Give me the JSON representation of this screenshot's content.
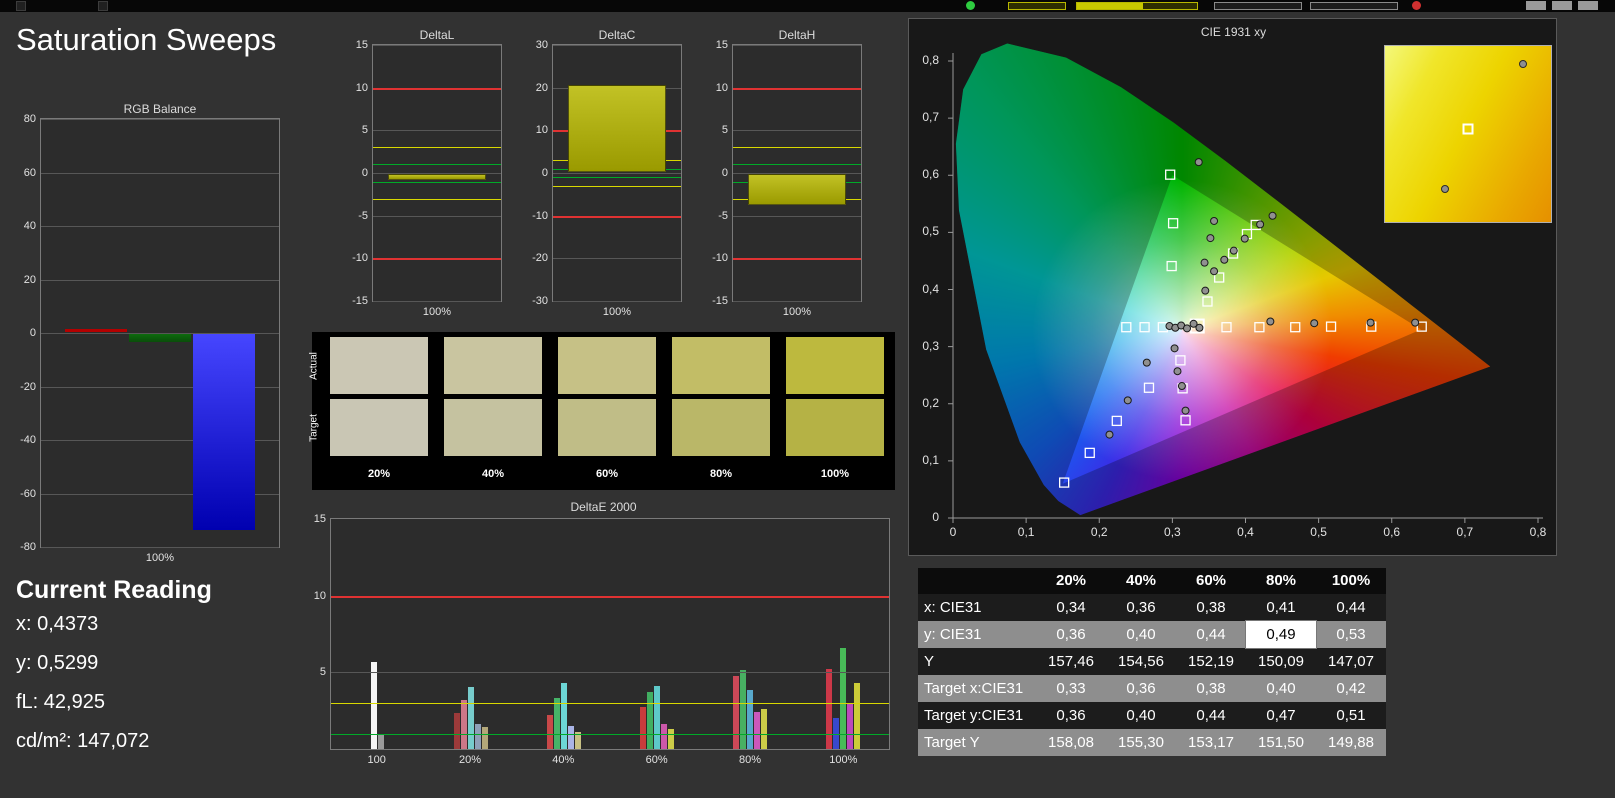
{
  "page": {
    "title": "Saturation Sweeps"
  },
  "colors": {
    "tolerance_red": "#e03232",
    "tolerance_yellow": "#d8d800",
    "tolerance_green": "#00aa28"
  },
  "top_bar": {
    "icons": [
      {
        "name": "status-dot",
        "color": "#2ecc40"
      },
      {
        "name": "record-dot",
        "color": "#d03030"
      }
    ]
  },
  "rgb_balance": {
    "title": "RGB Balance",
    "y_ticks": [
      "80",
      "60",
      "40",
      "20",
      "0",
      "-20",
      "-40",
      "-60",
      "-80"
    ],
    "ylim": [
      -80,
      80
    ],
    "x_label": "100%",
    "bars": [
      {
        "name": "red",
        "value": 1,
        "color": "#b40000",
        "color2": "#b40000"
      },
      {
        "name": "green",
        "value": -3,
        "color": "#0e6b0e",
        "color2": "#0a4d0a"
      },
      {
        "name": "blue",
        "value": -73,
        "color": "#4646ff",
        "color2": "#0000b0"
      }
    ]
  },
  "current_reading": {
    "title": "Current Reading",
    "lines": [
      "x: 0,4373",
      "y: 0,5299",
      "fL: 42,925",
      "cd/m²: 147,072"
    ]
  },
  "delta_charts": [
    {
      "title": "DeltaL",
      "ylim": 15,
      "y_ticks": [
        "15",
        "10",
        "5",
        "0",
        "-5",
        "-10",
        "-15"
      ],
      "x_label": "100%",
      "bar_value": -0.7
    },
    {
      "title": "DeltaC",
      "ylim": 30,
      "y_ticks": [
        "30",
        "20",
        "10",
        "0",
        "-10",
        "-20",
        "-30"
      ],
      "x_label": "100%",
      "bar_value": 20.3
    },
    {
      "title": "DeltaH",
      "ylim": 15,
      "y_ticks": [
        "15",
        "10",
        "5",
        "0",
        "-5",
        "-10",
        "-15"
      ],
      "x_label": "100%",
      "bar_value": -3.6
    }
  ],
  "tolerance_values": {
    "red": 10,
    "yellow": 3,
    "green": 1
  },
  "swatches": {
    "row_labels": [
      "Actual",
      "Target"
    ],
    "col_labels": [
      "20%",
      "40%",
      "60%",
      "80%",
      "100%"
    ],
    "actual_colors": [
      "#cbc7b4",
      "#c9c5a0",
      "#c6c186",
      "#c2bd66",
      "#bdb93e"
    ],
    "target_colors": [
      "#c9c6b4",
      "#c5c2a0",
      "#c0bd87",
      "#bab768",
      "#b5b245"
    ]
  },
  "deltae2000": {
    "title": "DeltaE 2000",
    "y_ticks": [
      "15",
      "10",
      "5"
    ],
    "ylim": [
      0,
      15
    ],
    "groups": [
      {
        "label": "100",
        "bars": [
          {
            "color": "#f5f5f5",
            "value": 5.6
          },
          {
            "color": "#9a9a9a",
            "value": 1.0
          }
        ]
      },
      {
        "label": "20%",
        "bars": [
          {
            "color": "#9c3a3a",
            "value": 2.3
          },
          {
            "color": "#cc7788",
            "value": 3.2
          },
          {
            "color": "#77cccc",
            "value": 4.0
          },
          {
            "color": "#8fa0b8",
            "value": 1.6
          },
          {
            "color": "#b3a87a",
            "value": 1.4
          }
        ]
      },
      {
        "label": "40%",
        "bars": [
          {
            "color": "#c84848",
            "value": 2.2
          },
          {
            "color": "#46b468",
            "value": 3.3
          },
          {
            "color": "#6cd6d6",
            "value": 4.3
          },
          {
            "color": "#aab4e6",
            "value": 1.5
          },
          {
            "color": "#c8c184",
            "value": 1.1
          }
        ]
      },
      {
        "label": "60%",
        "bars": [
          {
            "color": "#c83c3c",
            "value": 2.7
          },
          {
            "color": "#41ae61",
            "value": 3.7
          },
          {
            "color": "#5ec9c9",
            "value": 4.1
          },
          {
            "color": "#cc58aa",
            "value": 1.6
          },
          {
            "color": "#cccc48",
            "value": 1.3
          }
        ]
      },
      {
        "label": "80%",
        "bars": [
          {
            "color": "#cc4858",
            "value": 4.7
          },
          {
            "color": "#48b062",
            "value": 5.1
          },
          {
            "color": "#58a8cc",
            "value": 3.8
          },
          {
            "color": "#cc58bb",
            "value": 2.4
          },
          {
            "color": "#cccc48",
            "value": 2.6
          }
        ]
      },
      {
        "label": "100%",
        "bars": [
          {
            "color": "#cc3848",
            "value": 5.2
          },
          {
            "color": "#3848cc",
            "value": 2.0
          },
          {
            "color": "#48bb58",
            "value": 6.5
          },
          {
            "color": "#bb48bb",
            "value": 2.9
          },
          {
            "color": "#cccc38",
            "value": 4.3
          }
        ]
      }
    ]
  },
  "cie": {
    "title": "CIE 1931 xy",
    "x_ticks": [
      "0",
      "0,1",
      "0,2",
      "0,3",
      "0,4",
      "0,5",
      "0,6",
      "0,7",
      "0,8"
    ],
    "y_ticks": [
      "0",
      "0,1",
      "0,2",
      "0,3",
      "0,4",
      "0,5",
      "0,6",
      "0,7",
      "0,8"
    ],
    "primary_target": [
      0.334,
      0.336
    ],
    "targets": [
      [
        0.297,
        0.601
      ],
      [
        0.301,
        0.516
      ],
      [
        0.299,
        0.441
      ],
      [
        0.348,
        0.379
      ],
      [
        0.364,
        0.421
      ],
      [
        0.383,
        0.463
      ],
      [
        0.402,
        0.497
      ],
      [
        0.414,
        0.513
      ],
      [
        0.374,
        0.334
      ],
      [
        0.419,
        0.334
      ],
      [
        0.468,
        0.334
      ],
      [
        0.517,
        0.335
      ],
      [
        0.572,
        0.335
      ],
      [
        0.641,
        0.335
      ],
      [
        0.287,
        0.334
      ],
      [
        0.262,
        0.334
      ],
      [
        0.237,
        0.334
      ],
      [
        0.311,
        0.276
      ],
      [
        0.314,
        0.227
      ],
      [
        0.318,
        0.171
      ],
      [
        0.268,
        0.228
      ],
      [
        0.224,
        0.17
      ],
      [
        0.187,
        0.114
      ],
      [
        0.152,
        0.062
      ]
    ],
    "measurements": [
      [
        0.336,
        0.623
      ],
      [
        0.357,
        0.52
      ],
      [
        0.352,
        0.49
      ],
      [
        0.344,
        0.447
      ],
      [
        0.345,
        0.398
      ],
      [
        0.357,
        0.432
      ],
      [
        0.371,
        0.452
      ],
      [
        0.384,
        0.468
      ],
      [
        0.399,
        0.489
      ],
      [
        0.42,
        0.514
      ],
      [
        0.437,
        0.529
      ],
      [
        0.296,
        0.336
      ],
      [
        0.304,
        0.333
      ],
      [
        0.312,
        0.337
      ],
      [
        0.32,
        0.332
      ],
      [
        0.329,
        0.34
      ],
      [
        0.337,
        0.333
      ],
      [
        0.434,
        0.344
      ],
      [
        0.494,
        0.341
      ],
      [
        0.571,
        0.342
      ],
      [
        0.632,
        0.342
      ],
      [
        0.303,
        0.297
      ],
      [
        0.307,
        0.257
      ],
      [
        0.313,
        0.231
      ],
      [
        0.318,
        0.188
      ],
      [
        0.265,
        0.272
      ],
      [
        0.239,
        0.206
      ],
      [
        0.214,
        0.146
      ]
    ],
    "inset": {
      "square": [
        0.5,
        0.47
      ],
      "dots": [
        [
          0.36,
          0.81
        ],
        [
          0.83,
          0.1
        ]
      ]
    }
  },
  "table": {
    "columns": [
      "20%",
      "40%",
      "60%",
      "80%",
      "100%"
    ],
    "rows": [
      {
        "label": "x: CIE31",
        "values": [
          "0,34",
          "0,36",
          "0,38",
          "0,41",
          "0,44"
        ]
      },
      {
        "label": "y: CIE31",
        "values": [
          "0,36",
          "0,40",
          "0,44",
          "0,49",
          "0,53"
        ],
        "highlight": 3
      },
      {
        "label": "Y",
        "values": [
          "157,46",
          "154,56",
          "152,19",
          "150,09",
          "147,07"
        ]
      },
      {
        "label": "Target x:CIE31",
        "values": [
          "0,33",
          "0,36",
          "0,38",
          "0,40",
          "0,42"
        ]
      },
      {
        "label": "Target y:CIE31",
        "values": [
          "0,36",
          "0,40",
          "0,44",
          "0,47",
          "0,51"
        ]
      },
      {
        "label": "Target Y",
        "values": [
          "158,08",
          "155,30",
          "153,17",
          "151,50",
          "149,88"
        ]
      }
    ]
  }
}
